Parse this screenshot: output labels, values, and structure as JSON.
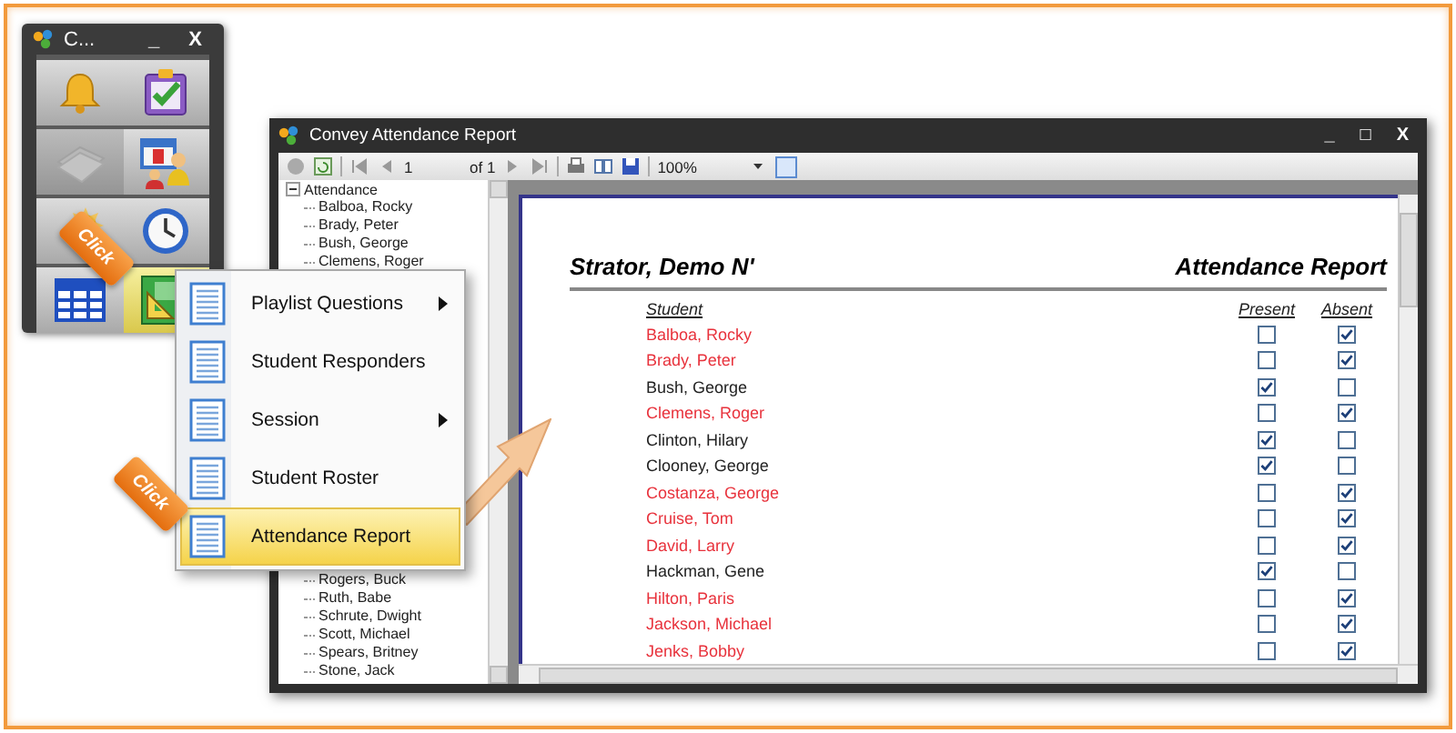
{
  "launcher": {
    "title": "C...",
    "controls": [
      "_",
      "X"
    ],
    "tiles": [
      {
        "kind": "bell",
        "selected": false,
        "disabled": false
      },
      {
        "kind": "clipboard",
        "selected": false,
        "disabled": false
      },
      {
        "kind": "papers",
        "selected": false,
        "disabled": true
      },
      {
        "kind": "quiz",
        "selected": false,
        "disabled": false
      },
      {
        "kind": "burst",
        "selected": false,
        "disabled": false
      },
      {
        "kind": "clock",
        "selected": false,
        "disabled": false
      },
      {
        "kind": "grid",
        "selected": false,
        "disabled": false
      },
      {
        "kind": "triangle",
        "selected": true,
        "disabled": false
      }
    ]
  },
  "report_window": {
    "title": "Convey Attendance Report",
    "controls": [
      "_",
      "□",
      "X"
    ],
    "toolbar": {
      "page": "1",
      "page_count": "of 1",
      "zoom": "100%"
    },
    "tree": {
      "label": "Attendance",
      "expanded": true,
      "children": [
        {
          "label": "Balboa, Rocky"
        },
        {
          "label": "Brady, Peter"
        },
        {
          "label": "Bush, George"
        },
        {
          "label": "Clemens, Roger"
        },
        {
          "label": "Rogers, Buck"
        },
        {
          "label": "Ruth, Babe"
        },
        {
          "label": "Schrute, Dwight"
        },
        {
          "label": "Scott, Michael"
        },
        {
          "label": "Spears, Britney"
        },
        {
          "label": "Stone, Jack"
        }
      ]
    },
    "report": {
      "name": "Strator, Demo N'",
      "title": "Attendance Report",
      "columns": [
        "Student",
        "Present",
        "Absent"
      ],
      "rows": [
        {
          "student": "Balboa, Rocky",
          "present": false,
          "absent": true
        },
        {
          "student": "Brady, Peter",
          "present": false,
          "absent": true
        },
        {
          "student": "Bush, George",
          "present": true,
          "absent": false
        },
        {
          "student": "Clemens, Roger",
          "present": false,
          "absent": true
        },
        {
          "student": "Clinton, Hilary",
          "present": true,
          "absent": false
        },
        {
          "student": "Clooney, George",
          "present": true,
          "absent": false
        },
        {
          "student": "Costanza, George",
          "present": false,
          "absent": true
        },
        {
          "student": "Cruise, Tom",
          "present": false,
          "absent": true
        },
        {
          "student": "David, Larry",
          "present": false,
          "absent": true
        },
        {
          "student": "Hackman, Gene",
          "present": true,
          "absent": false
        },
        {
          "student": "Hilton, Paris",
          "present": false,
          "absent": true
        },
        {
          "student": "Jackson, Michael",
          "present": false,
          "absent": true
        },
        {
          "student": "Jenks, Bobby",
          "present": false,
          "absent": true
        }
      ]
    }
  },
  "context_menu": {
    "items": [
      {
        "label": "Playlist Questions",
        "submenu": true,
        "selected": false
      },
      {
        "label": "Student Responders",
        "submenu": false,
        "selected": false
      },
      {
        "label": "Session",
        "submenu": true,
        "selected": false
      },
      {
        "label": "Student Roster",
        "submenu": false,
        "selected": false
      },
      {
        "label": "Attendance Report",
        "submenu": false,
        "selected": true
      }
    ]
  },
  "callouts": [
    {
      "label": "Click"
    },
    {
      "label": "Click"
    }
  ]
}
